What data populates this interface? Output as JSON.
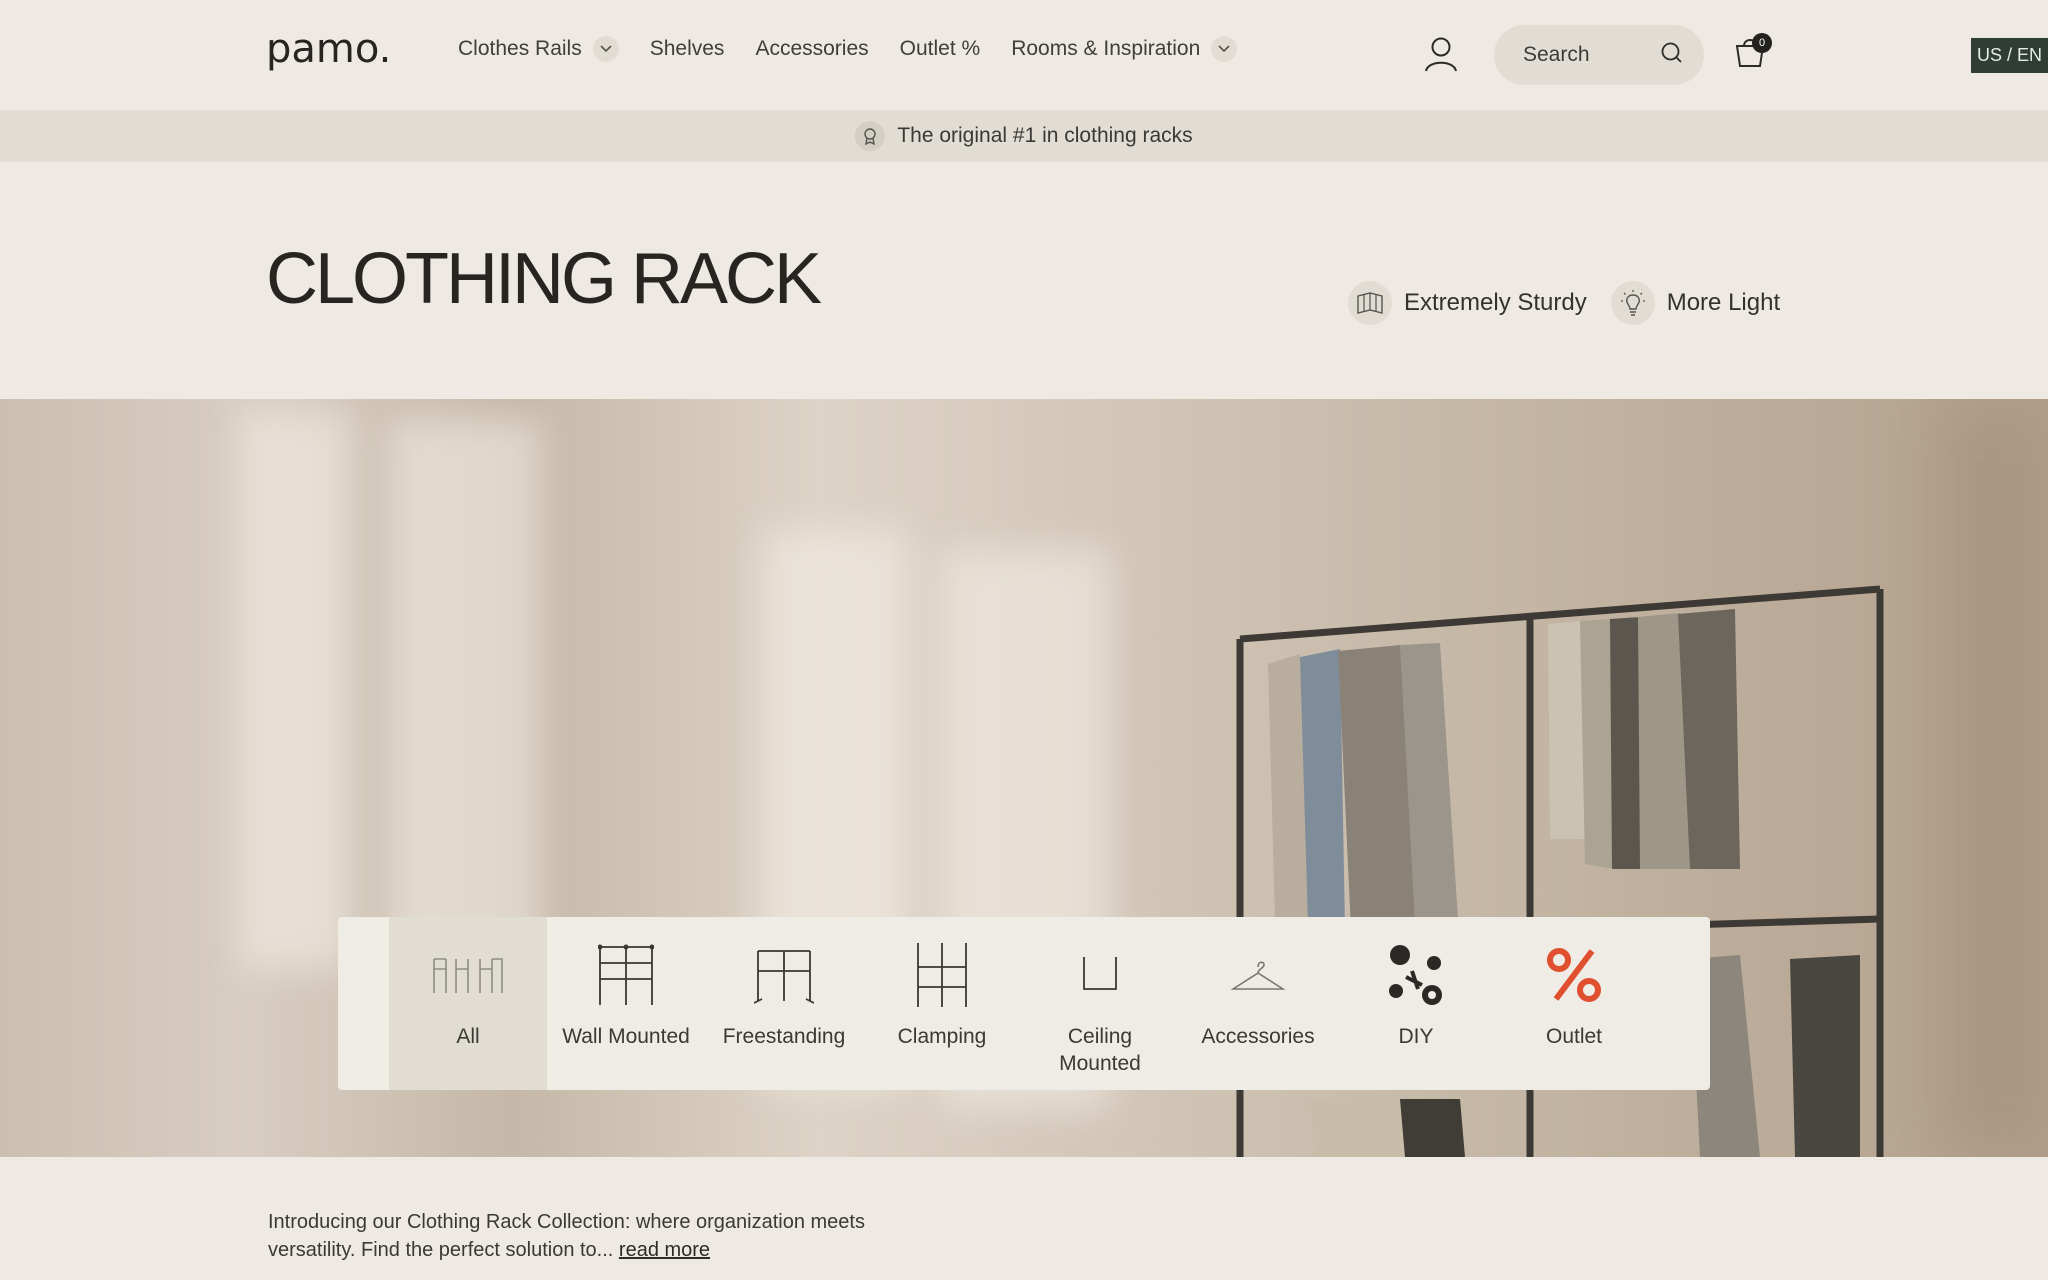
{
  "header": {
    "logo": "pamo.",
    "nav": [
      {
        "label": "Clothes Rails",
        "dropdown": true
      },
      {
        "label": "Shelves",
        "dropdown": false
      },
      {
        "label": "Accessories",
        "dropdown": false
      },
      {
        "label": "Outlet %",
        "dropdown": false
      },
      {
        "label": "Rooms & Inspiration",
        "dropdown": true
      }
    ],
    "search_placeholder": "Search",
    "cart_count": "0",
    "locale": "US / EN"
  },
  "announcement": {
    "icon": "award-icon",
    "text": "The original #1 in clothing racks"
  },
  "page": {
    "title": "CLOTHING RACK",
    "features": [
      {
        "icon": "sturdy-frame-icon",
        "label": "Extremely Sturdy"
      },
      {
        "icon": "lightbulb-icon",
        "label": "More Light"
      }
    ]
  },
  "categories": [
    {
      "label": "All",
      "icon": "all-racks-icon",
      "active": true
    },
    {
      "label": "Wall Mounted",
      "icon": "wall-mounted-icon",
      "active": false
    },
    {
      "label": "Freestanding",
      "icon": "freestanding-icon",
      "active": false
    },
    {
      "label": "Clamping",
      "icon": "clamping-icon",
      "active": false
    },
    {
      "label": "Ceiling Mounted",
      "icon": "ceiling-mounted-icon",
      "active": false
    },
    {
      "label": "Accessories",
      "icon": "hanger-icon",
      "active": false
    },
    {
      "label": "DIY",
      "icon": "diy-parts-icon",
      "active": false
    },
    {
      "label": "Outlet",
      "icon": "percent-icon",
      "active": false
    }
  ],
  "intro": {
    "text": "Introducing our Clothing Rack Collection: where organization meets versatility. Find the perfect solution to...",
    "read_more": "read more"
  },
  "colors": {
    "background": "#efe9e3",
    "locale_badge": "#2f3d34",
    "outlet_accent": "#e0502e"
  }
}
